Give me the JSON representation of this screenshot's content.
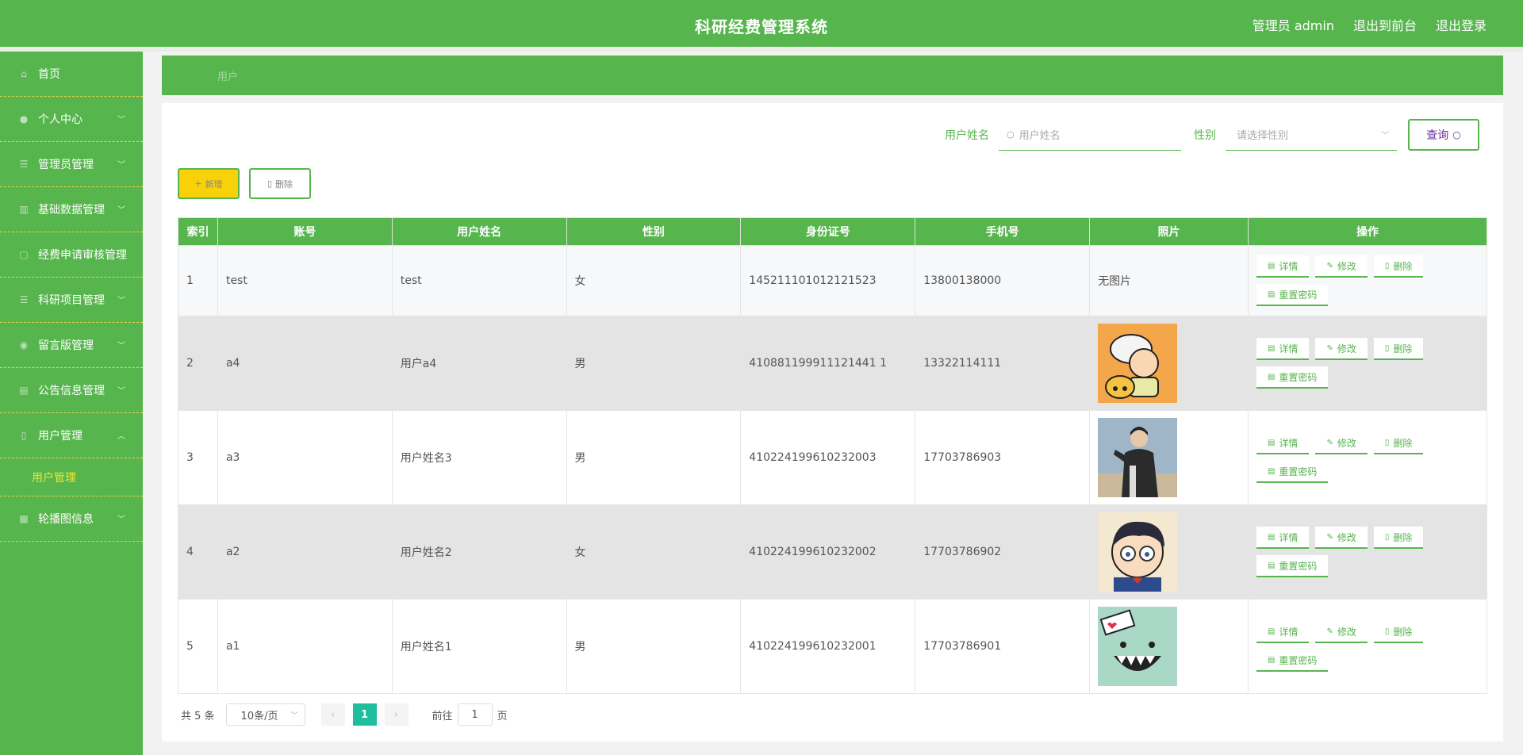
{
  "header": {
    "title": "科研经费管理系统",
    "user_label": "管理员 admin",
    "frontend_link": "退出到前台",
    "logout_link": "退出登录"
  },
  "sidebar": {
    "items": [
      {
        "label": "首页",
        "icon": "home-icon"
      },
      {
        "label": "个人中心",
        "icon": "user-icon"
      },
      {
        "label": "管理员管理",
        "icon": "list-icon"
      },
      {
        "label": "基础数据管理",
        "icon": "chart-icon"
      },
      {
        "label": "经费申请审核管理",
        "icon": "doc-icon"
      },
      {
        "label": "科研项目管理",
        "icon": "list-icon"
      },
      {
        "label": "留言版管理",
        "icon": "pin-icon"
      },
      {
        "label": "公告信息管理",
        "icon": "news-icon"
      },
      {
        "label": "用户管理",
        "icon": "user-icon"
      },
      {
        "label": "轮播图信息",
        "icon": "image-icon"
      }
    ],
    "sub_item": "用户管理"
  },
  "breadcrumb": "用户",
  "search": {
    "name_label": "用户姓名",
    "name_placeholder": "用户姓名",
    "gender_label": "性别",
    "gender_placeholder": "请选择性别",
    "query_button": "查询"
  },
  "toolbar": {
    "add_label": "新增",
    "delete_label": "删除"
  },
  "table": {
    "headers": [
      "索引",
      "账号",
      "用户姓名",
      "性别",
      "身份证号",
      "手机号",
      "照片",
      "操作"
    ],
    "rows": [
      {
        "index": "1",
        "account": "test",
        "name": "test",
        "gender": "女",
        "id_card": "145211101012121523",
        "phone": "13800138000",
        "photo": "无图片"
      },
      {
        "index": "2",
        "account": "a4",
        "name": "用户a4",
        "gender": "男",
        "id_card": "410881199911121441 1",
        "phone": "13322114111",
        "photo": ""
      },
      {
        "index": "3",
        "account": "a3",
        "name": "用户姓名3",
        "gender": "男",
        "id_card": "410224199610232003",
        "phone": "17703786903",
        "photo": ""
      },
      {
        "index": "4",
        "account": "a2",
        "name": "用户姓名2",
        "gender": "女",
        "id_card": "410224199610232002",
        "phone": "17703786902",
        "photo": ""
      },
      {
        "index": "5",
        "account": "a1",
        "name": "用户姓名1",
        "gender": "男",
        "id_card": "410224199610232001",
        "phone": "17703786901",
        "photo": ""
      }
    ],
    "actions": {
      "detail": "详情",
      "edit": "修改",
      "delete": "删除",
      "reset": "重置密码"
    }
  },
  "pager": {
    "total": "共 5 条",
    "page_size": "10条/页",
    "current": "1",
    "goto_prefix": "前往",
    "goto_value": "1",
    "goto_suffix": "页"
  },
  "colors": {
    "primary": "#57b54e",
    "accent": "#f8d108",
    "pager_active": "#1fbe9e"
  }
}
